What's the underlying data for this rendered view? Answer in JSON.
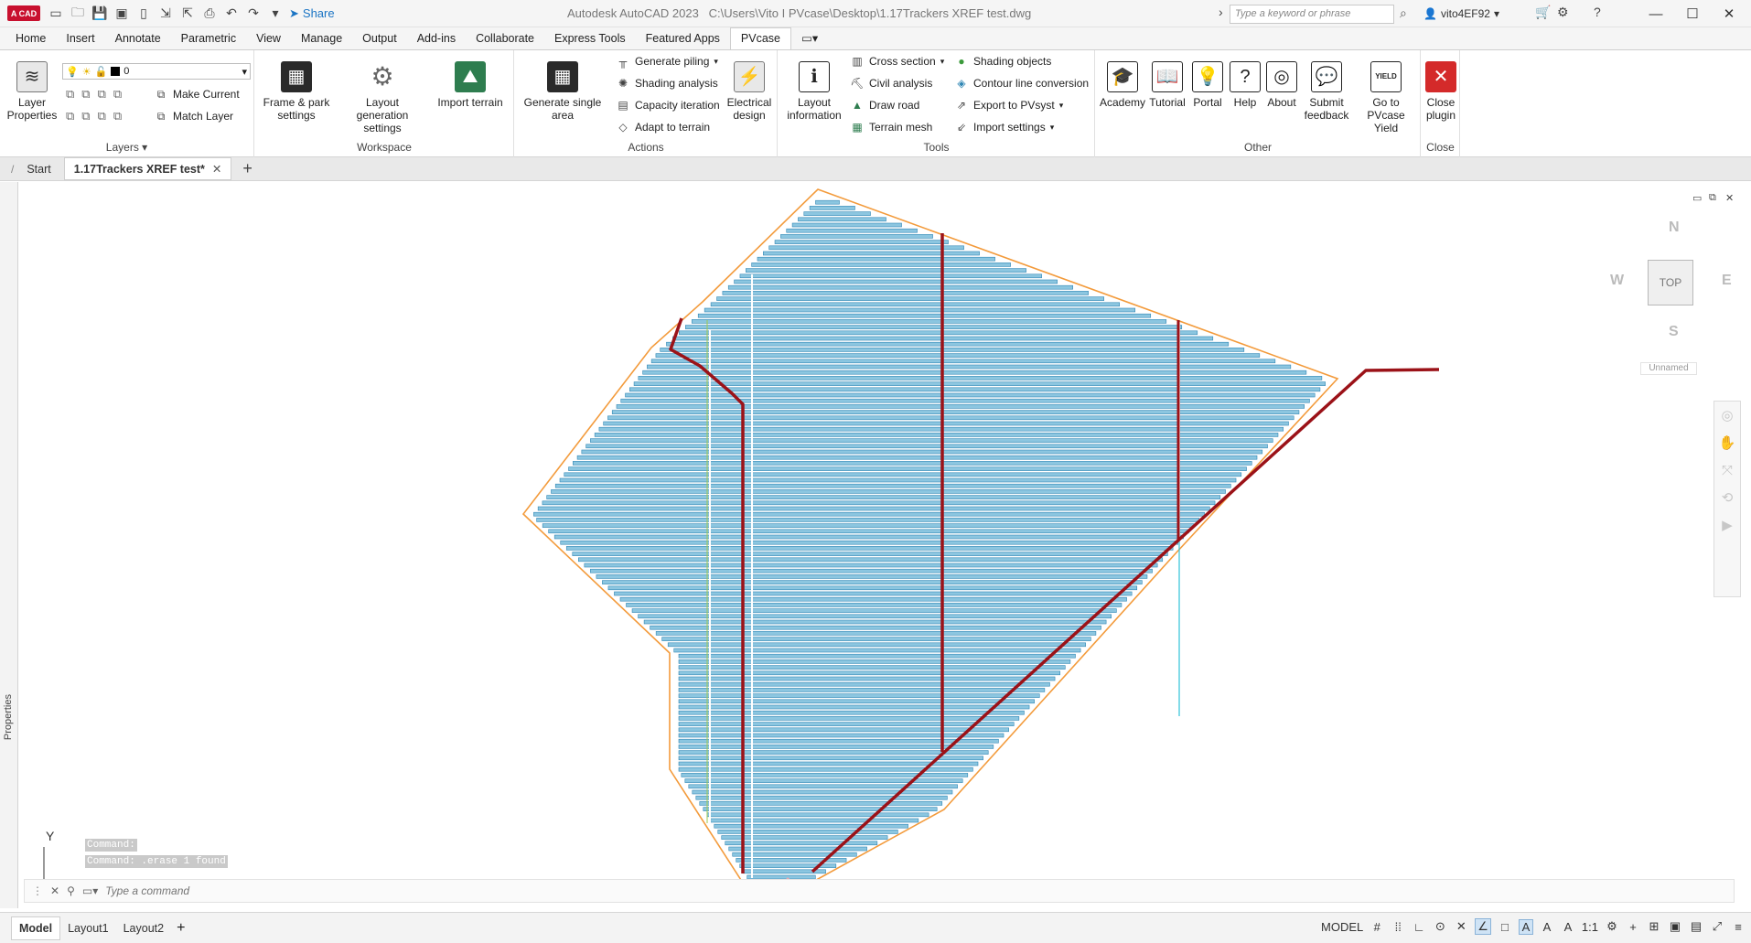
{
  "app": {
    "logo_text": "A CAD",
    "title": "Autodesk AutoCAD 2023",
    "file_path": "C:\\Users\\Vito I PVcase\\Desktop\\1.17Trackers XREF test.dwg",
    "share_label": "Share",
    "search_placeholder": "Type a keyword or phrase",
    "user": "vito4EF92"
  },
  "ribbon_tabs": [
    "Home",
    "Insert",
    "Annotate",
    "Parametric",
    "View",
    "Manage",
    "Output",
    "Add-ins",
    "Collaborate",
    "Express Tools",
    "Featured Apps",
    "PVcase"
  ],
  "active_tab": "PVcase",
  "panels": {
    "layers": {
      "title": "Layers",
      "layer_properties": "Layer Properties",
      "current_layer": "0",
      "make_current": "Make Current",
      "match_layer": "Match Layer"
    },
    "workspace": {
      "title": "Workspace",
      "frame_park": "Frame & park settings",
      "layout_gen": "Layout generation settings",
      "import_terrain": "Import terrain"
    },
    "actions": {
      "title": "Actions",
      "generate_single": "Generate single area",
      "generate_piling": "Generate piling",
      "shading_analysis": "Shading analysis",
      "capacity_iteration": "Capacity iteration",
      "adapt_terrain": "Adapt to terrain",
      "electrical_design": "Electrical design"
    },
    "tools": {
      "title": "Tools",
      "layout_info": "Layout information",
      "cross_section": "Cross section",
      "civil_analysis": "Civil analysis",
      "draw_road": "Draw road",
      "terrain_mesh": "Terrain mesh",
      "shading_objects": "Shading objects",
      "contour_conversion": "Contour line conversion",
      "export_pvsyst": "Export to PVsyst",
      "import_settings": "Import settings"
    },
    "other": {
      "title": "Other",
      "academy": "Academy",
      "tutorial": "Tutorial",
      "portal": "Portal",
      "help": "Help",
      "about": "About",
      "feedback": "Submit feedback",
      "yield": "Go to PVcase Yield",
      "yield_icon_text": "YIELD"
    },
    "close": {
      "title": "Close",
      "close_plugin": "Close plugin"
    }
  },
  "doc_tabs": [
    "Start",
    "1.17Trackers XREF test*"
  ],
  "viewcube": {
    "n": "N",
    "s": "S",
    "e": "E",
    "w": "W",
    "face": "TOP",
    "ucs": "Unnamed"
  },
  "side_palette": "Properties",
  "ucs_axis": "Y",
  "command": {
    "history": [
      "Command:",
      "Command:  .erase 1 found"
    ],
    "placeholder": "Type a command"
  },
  "layout_tabs": [
    "Model",
    "Layout1",
    "Layout2"
  ],
  "status": {
    "space": "MODEL",
    "scale": "1:1"
  },
  "colors": {
    "boundary": "#f39b3c",
    "road": "#9b1218",
    "panel_fill": "#8cc6e0",
    "panel_stroke": "#2f86b4",
    "cable": "#31c3d9",
    "setback": "#9ec94e",
    "road_light": "#e8a5ad"
  }
}
